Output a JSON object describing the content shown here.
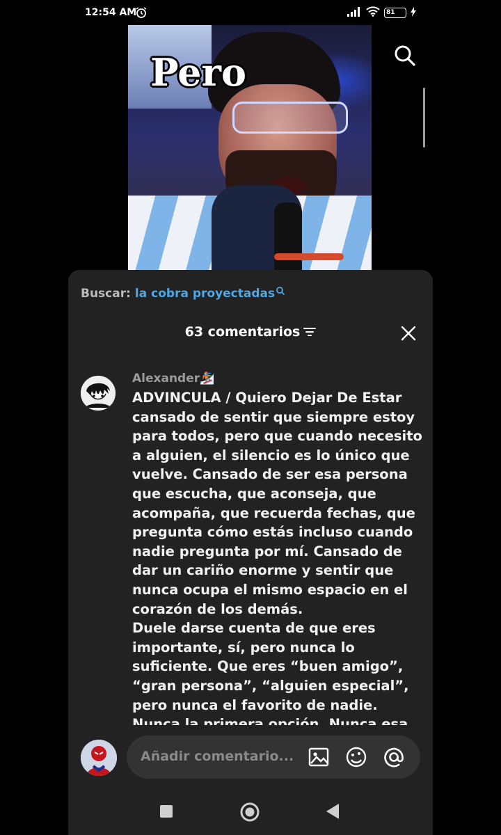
{
  "status_bar": {
    "time": "12:54 AM",
    "battery": "81"
  },
  "video": {
    "caption": "Pero"
  },
  "comments_panel": {
    "search_label": "Buscar:",
    "search_query": "la cobra proyectadas",
    "header": "63 comentarios",
    "comment": {
      "username": "Alexander🏂",
      "text": "ADVINCULA / Quiero Dejar De Estar cansado de sentir que siempre estoy para todos, pero que cuando necesito a alguien, el silencio es lo único que vuelve. Cansado de ser esa persona que escucha, que aconseja, que acompaña, que recuerda fechas, que pregunta cómo estás incluso cuando nadie pregunta por mí. Cansado de dar un cariño enorme y sentir que nunca ocupa el mismo espacio en el corazón de los demás.\nDuele darse cuenta de que eres importante, sí, pero nunca lo suficiente. Que eres “buen amigo”, “gran persona”, “alguien especial”, pero nunca el favorito de nadie. Nunca la primera opción. Nunca esa persona que buscan"
    },
    "input_placeholder": "Añadir comentario..."
  },
  "icons": {
    "search": "search-icon",
    "filter": "filter-icon",
    "close": "close-icon",
    "image": "image-icon",
    "emoji": "emoji-icon",
    "mention": "at-icon",
    "nav_square": "recents-icon",
    "nav_home": "home-icon",
    "nav_back": "back-icon"
  },
  "colors": {
    "panel_bg": "#222222",
    "link": "#4fa8e8",
    "input_bg": "#333333"
  }
}
